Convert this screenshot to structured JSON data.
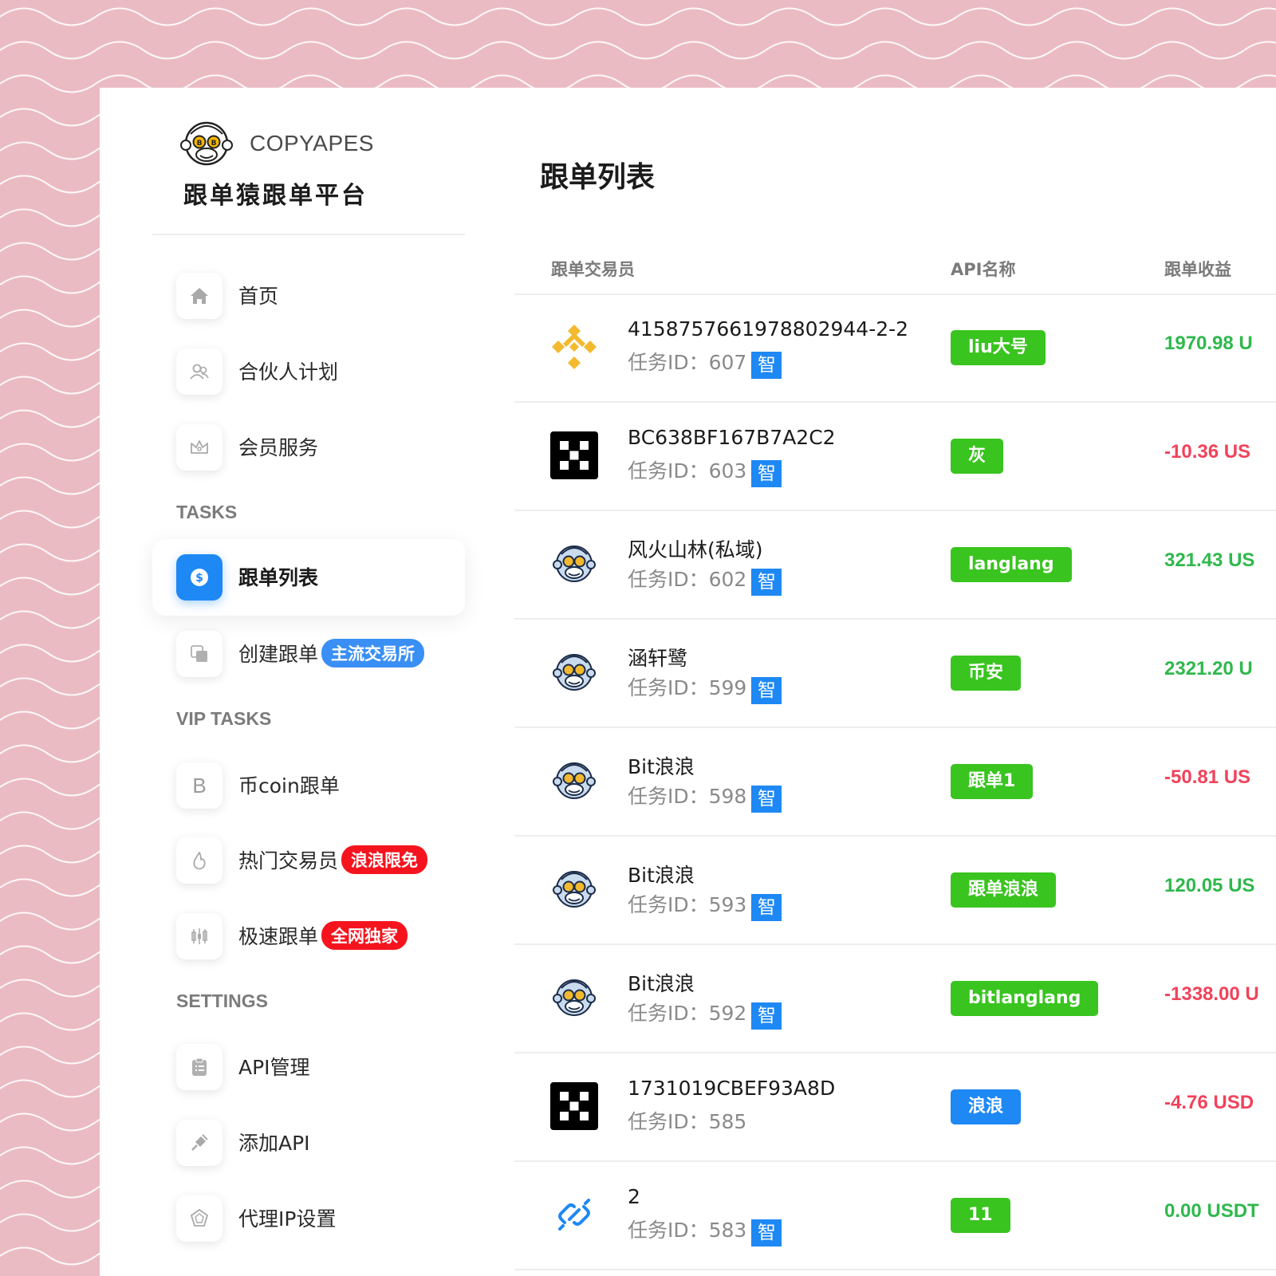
{
  "brand": {
    "name": "COPYAPES",
    "subtitle": "跟单猿跟单平台"
  },
  "sidebar": {
    "items_top": [
      {
        "label": "首页",
        "icon": "home-icon"
      },
      {
        "label": "合伙人计划",
        "icon": "partner-icon"
      },
      {
        "label": "会员服务",
        "icon": "crown-icon"
      }
    ],
    "section_tasks": "TASKS",
    "items_tasks": [
      {
        "label": "跟单列表",
        "icon": "dollar-icon",
        "active": true
      },
      {
        "label": "创建跟单",
        "icon": "copy-icon",
        "badge": "主流交易所",
        "badge_color": "#3a8ff5"
      }
    ],
    "section_vip": "VIP TASKS",
    "items_vip": [
      {
        "label": "币coin跟单",
        "icon": "b-letter-icon",
        "icon_text": "B"
      },
      {
        "label": "热门交易员",
        "icon": "flame-icon",
        "badge": "浪浪限免",
        "badge_color": "#f5141e"
      },
      {
        "label": "极速跟单",
        "icon": "candlestick-icon",
        "badge": "全网独家",
        "badge_color": "#f5141e"
      }
    ],
    "section_settings": "SETTINGS",
    "items_settings": [
      {
        "label": "API管理",
        "icon": "clipboard-icon"
      },
      {
        "label": "添加API",
        "icon": "plug-icon"
      },
      {
        "label": "代理IP设置",
        "icon": "proxy-icon"
      }
    ]
  },
  "main": {
    "title": "跟单列表",
    "columns": {
      "trader": "跟单交易员",
      "api": "API名称",
      "profit": "跟单收益"
    },
    "task_prefix": "任务ID：",
    "smart_tag": "智",
    "rows": [
      {
        "avatar": "binance-logo",
        "name": "4158757661978802944-2-2",
        "task_id": "607",
        "smart": true,
        "api": "liu大号",
        "api_color": "green",
        "profit": "1970.98 U",
        "profit_sign": "pos"
      },
      {
        "avatar": "okx-logo",
        "name": "BC638BF167B7A2C2",
        "task_id": "603",
        "smart": true,
        "api": "灰",
        "api_color": "green",
        "profit": "-10.36 US",
        "profit_sign": "neg"
      },
      {
        "avatar": "ape-avatar",
        "name": "风火山林(私域)",
        "task_id": "602",
        "smart": true,
        "api": "langlang",
        "api_color": "green",
        "profit": "321.43 US",
        "profit_sign": "pos"
      },
      {
        "avatar": "ape-avatar",
        "name": "涵轩鹭",
        "task_id": "599",
        "smart": true,
        "api": "币安",
        "api_color": "green",
        "profit": "2321.20 U",
        "profit_sign": "pos"
      },
      {
        "avatar": "ape-avatar",
        "name": "Bit浪浪",
        "task_id": "598",
        "smart": true,
        "api": "跟单1",
        "api_color": "green",
        "profit": "-50.81 US",
        "profit_sign": "neg"
      },
      {
        "avatar": "ape-avatar",
        "name": "Bit浪浪",
        "task_id": "593",
        "smart": true,
        "api": "跟单浪浪",
        "api_color": "green",
        "profit": "120.05 US",
        "profit_sign": "pos"
      },
      {
        "avatar": "ape-avatar",
        "name": "Bit浪浪",
        "task_id": "592",
        "smart": true,
        "api": "bitlanglang",
        "api_color": "green",
        "profit": "-1338.00 U",
        "profit_sign": "neg"
      },
      {
        "avatar": "okx-logo",
        "name": "1731019CBEF93A8D",
        "task_id": "585",
        "smart": false,
        "api": "浪浪",
        "api_color": "blue",
        "profit": "-4.76 USD",
        "profit_sign": "neg"
      },
      {
        "avatar": "link-icon",
        "name": "2",
        "task_id": "583",
        "smart": true,
        "api": "11",
        "api_color": "green",
        "profit": "0.00 USDT",
        "profit_sign": "pos"
      }
    ]
  },
  "colors": {
    "background": "#ebbbc4",
    "accent": "#1e88f5",
    "positive": "#2fb84c",
    "negative": "#f1425b",
    "tag_green": "#39c41f"
  }
}
